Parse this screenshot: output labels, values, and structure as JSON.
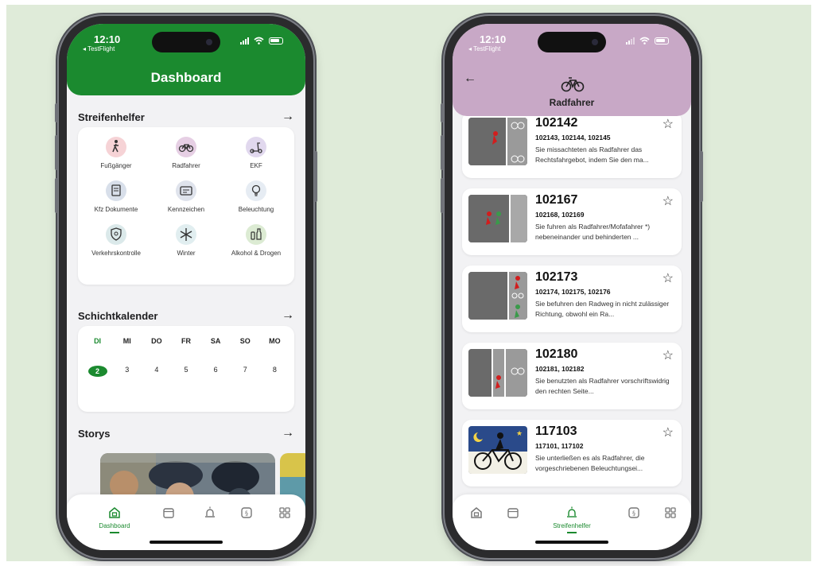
{
  "status": {
    "time": "12:10",
    "back_app": "◂ TestFlight"
  },
  "left": {
    "title": "Dashboard",
    "sections": {
      "streifenhelfer": "Streifenhelfer",
      "schichtkalender": "Schichtkalender",
      "storys": "Storys"
    },
    "grid": [
      {
        "label": "Fußgänger",
        "icon": "pedestrian-icon",
        "color": "#f6d3d6"
      },
      {
        "label": "Radfahrer",
        "icon": "bicycle-icon",
        "color": "#e6cfe4"
      },
      {
        "label": "EKF",
        "icon": "scooter-icon",
        "color": "#e1d8ee"
      },
      {
        "label": "Kfz Dokumente",
        "icon": "document-icon",
        "color": "#d8dfea"
      },
      {
        "label": "Kennzeichen",
        "icon": "license-plate-icon",
        "color": "#dfe3ec"
      },
      {
        "label": "Beleuchtung",
        "icon": "lightbulb-icon",
        "color": "#e6ecf3"
      },
      {
        "label": "Verkehrskontrolle",
        "icon": "shield-icon",
        "color": "#dbe9ea"
      },
      {
        "label": "Winter",
        "icon": "snowflake-icon",
        "color": "#e1eef0"
      },
      {
        "label": "Alkohol & Drogen",
        "icon": "bottle-icon",
        "color": "#dcebd3"
      }
    ],
    "calendar": {
      "days": [
        "DI",
        "MI",
        "DO",
        "FR",
        "SA",
        "SO",
        "MO"
      ],
      "dates": [
        "2",
        "3",
        "4",
        "5",
        "6",
        "7",
        "8"
      ]
    },
    "tabs": {
      "active_label": "Dashboard"
    }
  },
  "right": {
    "title": "Radfahrer",
    "items": [
      {
        "code": "102142",
        "related": "102143, 102144, 102145",
        "desc": "Sie missachteten als Radfahrer das Rechtsfahrgebot, indem Sie den ma..."
      },
      {
        "code": "102167",
        "related": "102168, 102169",
        "desc": "Sie fuhren als Radfahrer/Mofafahrer *) nebeneinander und behinderten ..."
      },
      {
        "code": "102173",
        "related": "102174, 102175, 102176",
        "desc": "Sie befuhren den Radweg in nicht zulässiger Richtung, obwohl ein Ra..."
      },
      {
        "code": "102180",
        "related": "102181, 102182",
        "desc": "Sie benutzten als Radfahrer vorschriftswidrig den rechten Seite..."
      },
      {
        "code": "117103",
        "related": "117101, 117102",
        "desc": "Sie unterließen es als Radfahrer, die vorgeschriebenen Beleuchtungsei..."
      }
    ],
    "tabs": {
      "active_label": "Streifenhelfer"
    }
  },
  "colors": {
    "green": "#1b8a2f",
    "lilac": "#c8a8c6",
    "backdrop": "#dfebd9"
  }
}
